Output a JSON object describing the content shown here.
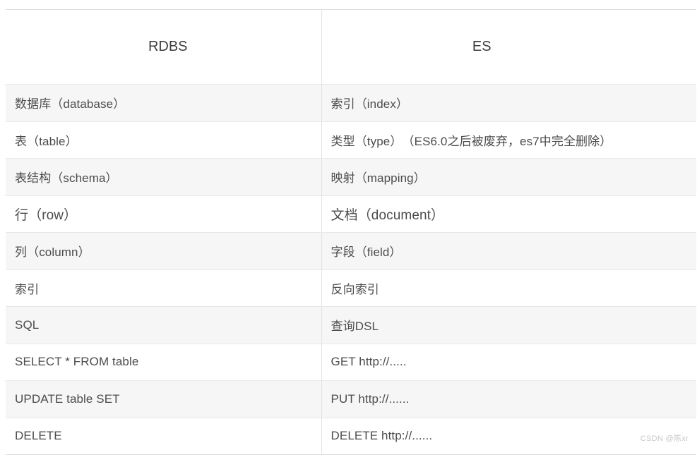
{
  "table": {
    "headers": [
      {
        "label": "RDBS",
        "align": "center"
      },
      {
        "label": "ES",
        "align": "center"
      }
    ],
    "rows": [
      {
        "rdbs": "数据库（database）",
        "es": "索引（index）"
      },
      {
        "rdbs": "表（table）",
        "es": "类型（type）　（ES6.0之后被废弃，es7中完全删除）"
      },
      {
        "rdbs": "表结构（schema）",
        "es": "映射（mapping）"
      },
      {
        "rdbs": "行（row）",
        "es": "文档（document）"
      },
      {
        "rdbs": "列（column）",
        "es": "字段（field）"
      },
      {
        "rdbs": "索引",
        "es": "反向索引"
      },
      {
        "rdbs": "SQL",
        "es": "查询DSL"
      },
      {
        "rdbs": "SELECT * FROM table",
        "es": "GET http://....."
      },
      {
        "rdbs": "UPDATE table SET",
        "es": "PUT  http://......"
      },
      {
        "rdbs": "DELETE",
        "es": "DELETE  http://......"
      }
    ]
  },
  "watermark": {
    "text": "CSDN @陈xr"
  },
  "colors": {
    "shade_row": "#f6f6f6",
    "plain_row": "#ffffff",
    "border": "#e2e2e2",
    "text": "#4c4c4c",
    "header_text": "#3f3f3f",
    "watermark_text": "#c8c8c8"
  }
}
